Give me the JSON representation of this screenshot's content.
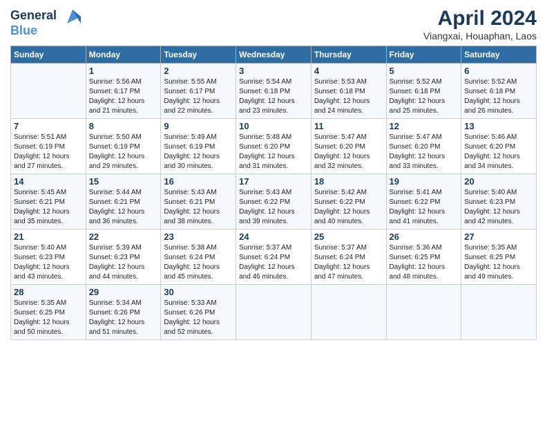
{
  "logo": {
    "line1": "General",
    "line2": "Blue"
  },
  "title": "April 2024",
  "subtitle": "Viangxai, Houaphan, Laos",
  "headers": [
    "Sunday",
    "Monday",
    "Tuesday",
    "Wednesday",
    "Thursday",
    "Friday",
    "Saturday"
  ],
  "weeks": [
    [
      {
        "day": "",
        "info": ""
      },
      {
        "day": "1",
        "info": "Sunrise: 5:56 AM\nSunset: 6:17 PM\nDaylight: 12 hours\nand 21 minutes."
      },
      {
        "day": "2",
        "info": "Sunrise: 5:55 AM\nSunset: 6:17 PM\nDaylight: 12 hours\nand 22 minutes."
      },
      {
        "day": "3",
        "info": "Sunrise: 5:54 AM\nSunset: 6:18 PM\nDaylight: 12 hours\nand 23 minutes."
      },
      {
        "day": "4",
        "info": "Sunrise: 5:53 AM\nSunset: 6:18 PM\nDaylight: 12 hours\nand 24 minutes."
      },
      {
        "day": "5",
        "info": "Sunrise: 5:52 AM\nSunset: 6:18 PM\nDaylight: 12 hours\nand 25 minutes."
      },
      {
        "day": "6",
        "info": "Sunrise: 5:52 AM\nSunset: 6:18 PM\nDaylight: 12 hours\nand 26 minutes."
      }
    ],
    [
      {
        "day": "7",
        "info": "Sunrise: 5:51 AM\nSunset: 6:19 PM\nDaylight: 12 hours\nand 27 minutes."
      },
      {
        "day": "8",
        "info": "Sunrise: 5:50 AM\nSunset: 6:19 PM\nDaylight: 12 hours\nand 29 minutes."
      },
      {
        "day": "9",
        "info": "Sunrise: 5:49 AM\nSunset: 6:19 PM\nDaylight: 12 hours\nand 30 minutes."
      },
      {
        "day": "10",
        "info": "Sunrise: 5:48 AM\nSunset: 6:20 PM\nDaylight: 12 hours\nand 31 minutes."
      },
      {
        "day": "11",
        "info": "Sunrise: 5:47 AM\nSunset: 6:20 PM\nDaylight: 12 hours\nand 32 minutes."
      },
      {
        "day": "12",
        "info": "Sunrise: 5:47 AM\nSunset: 6:20 PM\nDaylight: 12 hours\nand 33 minutes."
      },
      {
        "day": "13",
        "info": "Sunrise: 5:46 AM\nSunset: 6:20 PM\nDaylight: 12 hours\nand 34 minutes."
      }
    ],
    [
      {
        "day": "14",
        "info": "Sunrise: 5:45 AM\nSunset: 6:21 PM\nDaylight: 12 hours\nand 35 minutes."
      },
      {
        "day": "15",
        "info": "Sunrise: 5:44 AM\nSunset: 6:21 PM\nDaylight: 12 hours\nand 36 minutes."
      },
      {
        "day": "16",
        "info": "Sunrise: 5:43 AM\nSunset: 6:21 PM\nDaylight: 12 hours\nand 38 minutes."
      },
      {
        "day": "17",
        "info": "Sunrise: 5:43 AM\nSunset: 6:22 PM\nDaylight: 12 hours\nand 39 minutes."
      },
      {
        "day": "18",
        "info": "Sunrise: 5:42 AM\nSunset: 6:22 PM\nDaylight: 12 hours\nand 40 minutes."
      },
      {
        "day": "19",
        "info": "Sunrise: 5:41 AM\nSunset: 6:22 PM\nDaylight: 12 hours\nand 41 minutes."
      },
      {
        "day": "20",
        "info": "Sunrise: 5:40 AM\nSunset: 6:23 PM\nDaylight: 12 hours\nand 42 minutes."
      }
    ],
    [
      {
        "day": "21",
        "info": "Sunrise: 5:40 AM\nSunset: 6:23 PM\nDaylight: 12 hours\nand 43 minutes."
      },
      {
        "day": "22",
        "info": "Sunrise: 5:39 AM\nSunset: 6:23 PM\nDaylight: 12 hours\nand 44 minutes."
      },
      {
        "day": "23",
        "info": "Sunrise: 5:38 AM\nSunset: 6:24 PM\nDaylight: 12 hours\nand 45 minutes."
      },
      {
        "day": "24",
        "info": "Sunrise: 5:37 AM\nSunset: 6:24 PM\nDaylight: 12 hours\nand 46 minutes."
      },
      {
        "day": "25",
        "info": "Sunrise: 5:37 AM\nSunset: 6:24 PM\nDaylight: 12 hours\nand 47 minutes."
      },
      {
        "day": "26",
        "info": "Sunrise: 5:36 AM\nSunset: 6:25 PM\nDaylight: 12 hours\nand 48 minutes."
      },
      {
        "day": "27",
        "info": "Sunrise: 5:35 AM\nSunset: 6:25 PM\nDaylight: 12 hours\nand 49 minutes."
      }
    ],
    [
      {
        "day": "28",
        "info": "Sunrise: 5:35 AM\nSunset: 6:25 PM\nDaylight: 12 hours\nand 50 minutes."
      },
      {
        "day": "29",
        "info": "Sunrise: 5:34 AM\nSunset: 6:26 PM\nDaylight: 12 hours\nand 51 minutes."
      },
      {
        "day": "30",
        "info": "Sunrise: 5:33 AM\nSunset: 6:26 PM\nDaylight: 12 hours\nand 52 minutes."
      },
      {
        "day": "",
        "info": ""
      },
      {
        "day": "",
        "info": ""
      },
      {
        "day": "",
        "info": ""
      },
      {
        "day": "",
        "info": ""
      }
    ]
  ]
}
